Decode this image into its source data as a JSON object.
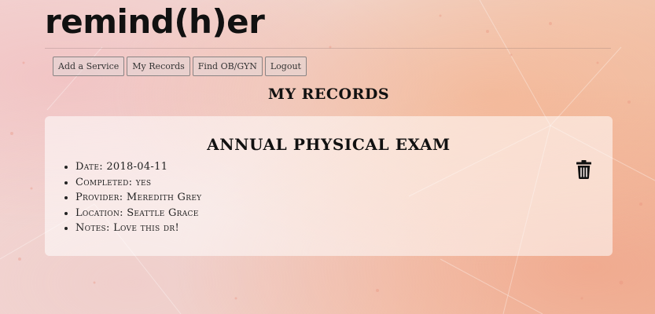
{
  "app": {
    "logo": "remind(h)er"
  },
  "nav": {
    "items": [
      {
        "label": "Add a Service"
      },
      {
        "label": "My Records"
      },
      {
        "label": "Find OB/GYN"
      },
      {
        "label": "Logout"
      }
    ]
  },
  "page": {
    "title": "MY RECORDS"
  },
  "record": {
    "title": "ANNUAL PHYSICAL EXAM",
    "date": "Date: 2018-04-11",
    "completed": "Completed: yes",
    "provider": "Provider: Meredith Grey",
    "location": "Location: Seattle Grace",
    "notes": "Notes: Love this dr!",
    "delete_icon": "trash-icon"
  }
}
